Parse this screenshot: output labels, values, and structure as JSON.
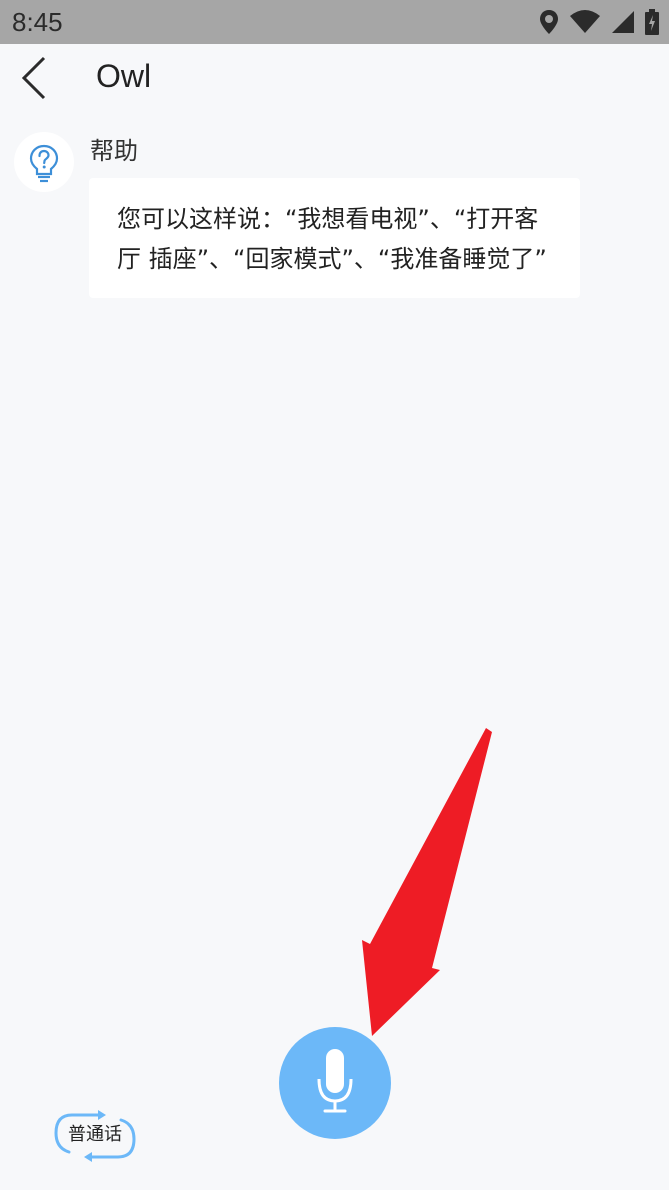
{
  "status_bar": {
    "time": "8:45",
    "icons": [
      "location-icon",
      "wifi-icon",
      "signal-icon",
      "battery-charging-icon"
    ]
  },
  "app_bar": {
    "title": "Owl",
    "back_icon": "chevron-left-icon"
  },
  "help_card": {
    "label": "帮助",
    "icon": "lightbulb-question-icon",
    "message_lines": [
      "您可以这样说：“我想看电视”、“打开客",
      "厅 插座”、“回家模式”、“我准备睡觉了”"
    ]
  },
  "language_toggle": {
    "label": "普通话",
    "icon": "switch-arrows-icon"
  },
  "mic_button": {
    "icon": "microphone-icon",
    "color": "#6cb8f8"
  },
  "annotation": {
    "icon": "red-arrow-icon",
    "color": "#ee1c25"
  }
}
